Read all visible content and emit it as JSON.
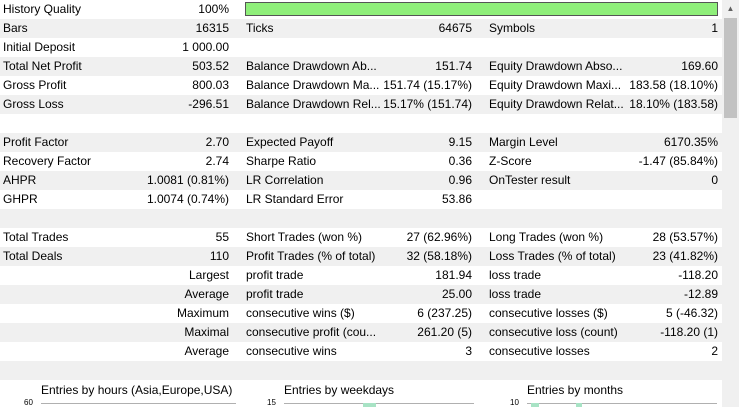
{
  "header": {
    "history_quality_label": "History Quality",
    "history_quality_value": "100%",
    "history_quality_fill": 1.0
  },
  "rows": {
    "bars": {
      "c0l": "Bars",
      "c0v": "16315",
      "c1l": "Ticks",
      "c1v": "64675",
      "c2l": "Symbols",
      "c2v": "1"
    },
    "deposit": {
      "c0l": "Initial Deposit",
      "c0v": "1 000.00"
    },
    "net_profit": {
      "c0l": "Total Net Profit",
      "c0v": "503.52",
      "c1l": "Balance Drawdown Ab...",
      "c1v": "151.74",
      "c2l": "Equity Drawdown Abso...",
      "c2v": "169.60"
    },
    "gross_profit": {
      "c0l": "Gross Profit",
      "c0v": "800.03",
      "c1l": "Balance Drawdown Ma...",
      "c1v": "151.74 (15.17%)",
      "c2l": "Equity Drawdown Maxi...",
      "c2v": "183.58 (18.10%)"
    },
    "gross_loss": {
      "c0l": "Gross Loss",
      "c0v": "-296.51",
      "c1l": "Balance Drawdown Rel...",
      "c1v": "15.17% (151.74)",
      "c2l": "Equity Drawdown Relat...",
      "c2v": "18.10% (183.58)"
    },
    "profit_factor": {
      "c0l": "Profit Factor",
      "c0v": "2.70",
      "c1l": "Expected Payoff",
      "c1v": "9.15",
      "c2l": "Margin Level",
      "c2v": "6170.35%"
    },
    "recovery": {
      "c0l": "Recovery Factor",
      "c0v": "2.74",
      "c1l": "Sharpe Ratio",
      "c1v": "0.36",
      "c2l": "Z-Score",
      "c2v": "-1.47 (85.84%)"
    },
    "ahpr": {
      "c0l": "AHPR",
      "c0v": "1.0081 (0.81%)",
      "c1l": "LR Correlation",
      "c1v": "0.96",
      "c2l": "OnTester result",
      "c2v": "0"
    },
    "ghpr": {
      "c0l": "GHPR",
      "c0v": "1.0074 (0.74%)",
      "c1l": "LR Standard Error",
      "c1v": "53.86"
    },
    "total_trades": {
      "c0l": "Total Trades",
      "c0v": "55",
      "c1l": "Short Trades (won %)",
      "c1v": "27 (62.96%)",
      "c2l": "Long Trades (won %)",
      "c2v": "28 (53.57%)"
    },
    "total_deals": {
      "c0l": "Total Deals",
      "c0v": "110",
      "c1l": "Profit Trades (% of total)",
      "c1v": "32 (58.18%)",
      "c2l": "Loss Trades (% of total)",
      "c2v": "23 (41.82%)"
    },
    "largest": {
      "c0r": "Largest",
      "c1l": "profit trade",
      "c1v": "181.94",
      "c2l": "loss trade",
      "c2v": "-118.20"
    },
    "average": {
      "c0r": "Average",
      "c1l": "profit trade",
      "c1v": "25.00",
      "c2l": "loss trade",
      "c2v": "-12.89"
    },
    "maximum": {
      "c0r": "Maximum",
      "c1l": "consecutive wins ($)",
      "c1v": "6 (237.25)",
      "c2l": "consecutive losses ($)",
      "c2v": "5 (-46.32)"
    },
    "maximal": {
      "c0r": "Maximal",
      "c1l": "consecutive profit (cou...",
      "c1v": "261.20 (5)",
      "c2l": "consecutive loss (count)",
      "c2v": "-118.20 (1)"
    },
    "average_consec": {
      "c0r": "Average",
      "c1l": "consecutive wins",
      "c1v": "3",
      "c2l": "consecutive losses",
      "c2v": "2"
    }
  },
  "charts": {
    "hours": {
      "title": "Entries by hours (Asia,Europe,USA)",
      "ymax": "60"
    },
    "weekdays": {
      "title": "Entries by weekdays",
      "ymax": "15"
    },
    "months": {
      "title": "Entries by months",
      "ymax": "10"
    }
  },
  "colors": {
    "quality_bar": "#8fef7a",
    "row_shade": "#f0f0f0",
    "chart_bar": "#a8e3c5"
  }
}
